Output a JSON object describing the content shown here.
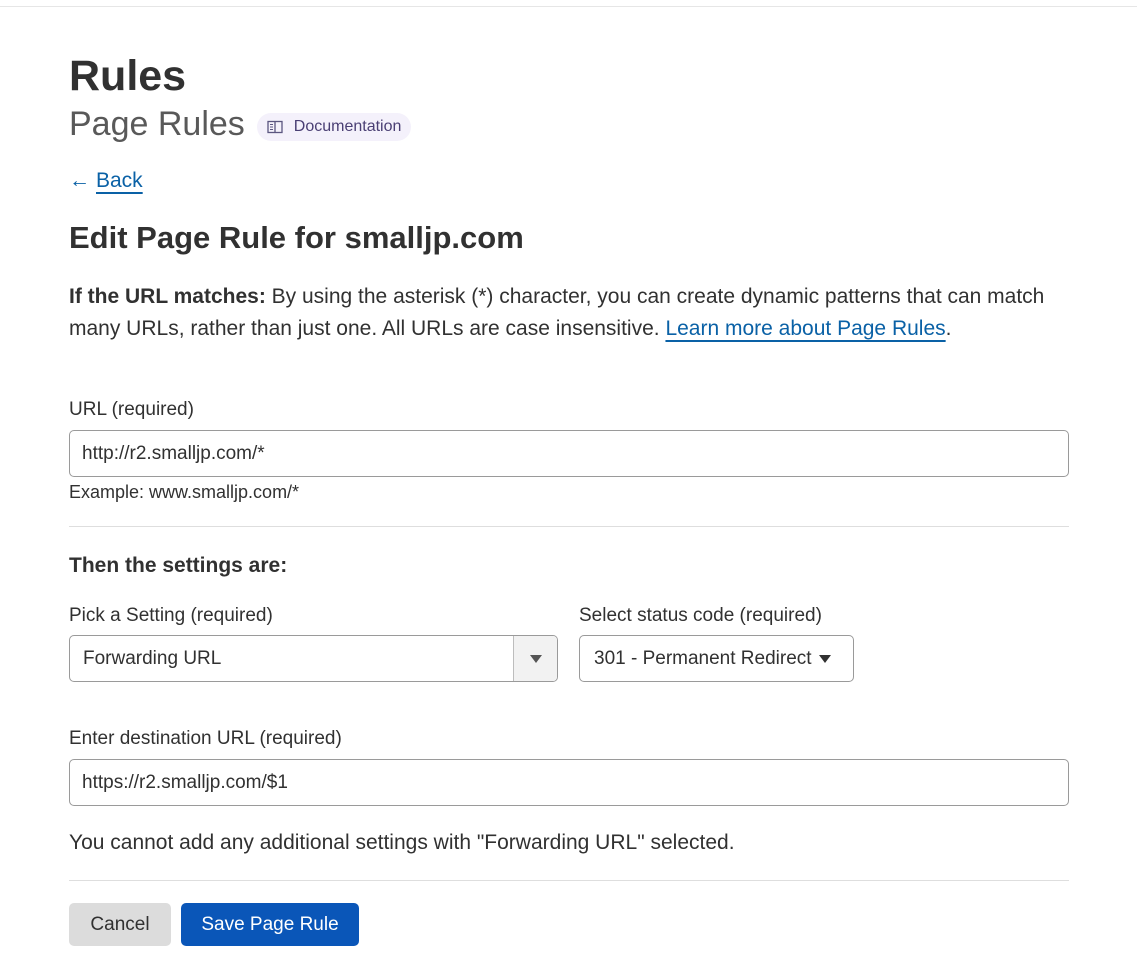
{
  "header": {
    "title": "Rules",
    "subtitle": "Page Rules",
    "doc_badge": {
      "label": "Documentation",
      "icon": "book-icon"
    }
  },
  "nav": {
    "back_arrow": "←",
    "back_label": "Back"
  },
  "form": {
    "heading": "Edit Page Rule for smalljp.com",
    "intro": {
      "bold": "If the URL matches:",
      "text": " By using the asterisk (*) character, you can create dynamic patterns that can match many URLs, rather than just one. All URLs are case insensitive. ",
      "link": "Learn more about Page Rules",
      "end": "."
    },
    "url": {
      "label": "URL (required)",
      "value": "http://r2.smalljp.com/*",
      "hint": "Example: www.smalljp.com/*"
    },
    "settings_heading": "Then the settings are:",
    "setting": {
      "label": "Pick a Setting (required)",
      "value": "Forwarding URL"
    },
    "status_code": {
      "label": "Select status code (required)",
      "value": "301 - Permanent Redirect"
    },
    "destination": {
      "label": "Enter destination URL (required)",
      "value": "https://r2.smalljp.com/$1"
    },
    "notice": "You cannot add any additional settings with \"Forwarding URL\" selected."
  },
  "actions": {
    "cancel_label": "Cancel",
    "save_label": "Save Page Rule"
  },
  "colors": {
    "link": "#0a61a6",
    "primary_button": "#0a56b8",
    "secondary_button": "#dcdcdc",
    "badge_bg": "#f4f1fb"
  }
}
